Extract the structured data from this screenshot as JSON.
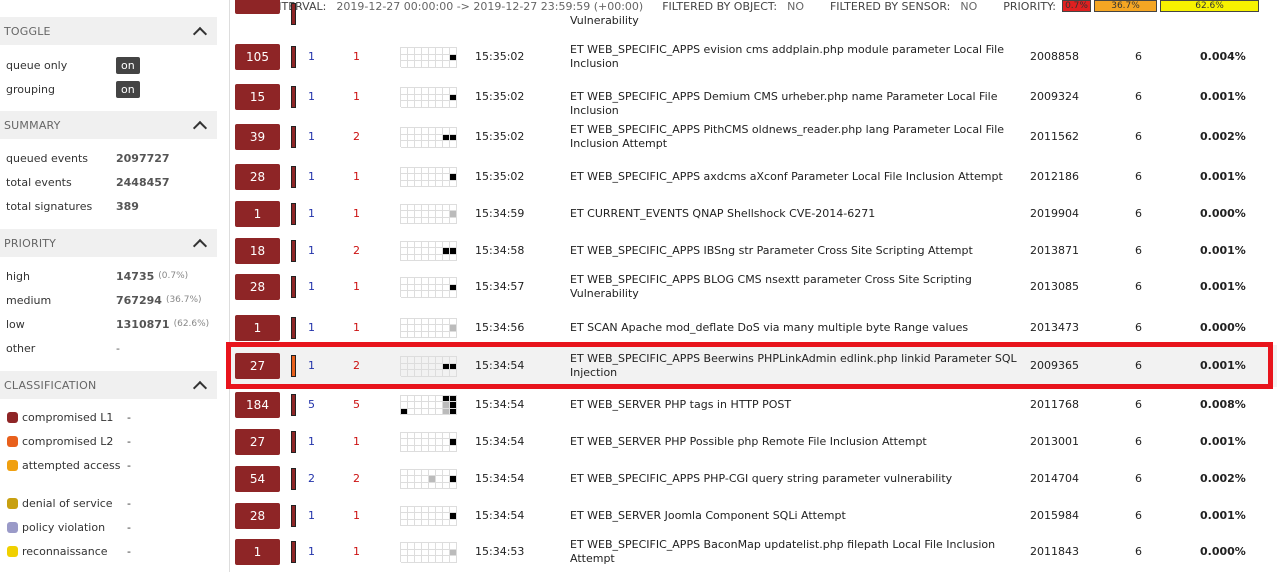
{
  "topbar": {
    "interval_label": "INTERVAL:",
    "interval_value": "2019-12-27 00:00:00 -> 2019-12-27 23:59:59 (+00:00)",
    "filter_object_label": "FILTERED BY OBJECT:",
    "filter_object_value": "NO",
    "filter_sensor_label": "FILTERED BY SENSOR:",
    "filter_sensor_value": "NO",
    "priority_label": "PRIORITY:",
    "priority_bars": [
      {
        "text": "0.7%",
        "color": "#e02020"
      },
      {
        "text": "36.7%",
        "color": "#f5a623"
      },
      {
        "text": "62.6%",
        "color": "#f7f200"
      }
    ]
  },
  "sidebar": {
    "toggle": {
      "title": "TOGGLE",
      "items": [
        {
          "label": "queue only",
          "value": "on"
        },
        {
          "label": "grouping",
          "value": "on"
        }
      ]
    },
    "summary": {
      "title": "SUMMARY",
      "items": [
        {
          "label": "queued events",
          "value": "2097727"
        },
        {
          "label": "total events",
          "value": "2448457"
        },
        {
          "label": "total signatures",
          "value": "389"
        }
      ]
    },
    "priority": {
      "title": "PRIORITY",
      "items": [
        {
          "label": "high",
          "value": "14735",
          "pct": "(0.7%)"
        },
        {
          "label": "medium",
          "value": "767294",
          "pct": "(36.7%)"
        },
        {
          "label": "low",
          "value": "1310871",
          "pct": "(62.6%)"
        },
        {
          "label": "other",
          "value": "-",
          "pct": ""
        }
      ]
    },
    "classification": {
      "title": "CLASSIFICATION",
      "items": [
        {
          "label": "compromised L1",
          "value": "-",
          "color": "#8e2526"
        },
        {
          "label": "compromised L2",
          "value": "-",
          "color": "#e8601c"
        },
        {
          "label": "attempted access",
          "value": "-",
          "color": "#f0a010"
        },
        {
          "label": "denial of service",
          "value": "-",
          "color": "#c8a010"
        },
        {
          "label": "policy violation",
          "value": "-",
          "color": "#9a9ac8"
        },
        {
          "label": "reconnaissance",
          "value": "-",
          "color": "#f0d000"
        }
      ]
    }
  },
  "events": [
    {
      "count": "",
      "n1": "",
      "n2": "",
      "time": "",
      "sig": "Vulnerability",
      "sid": "",
      "rev": "",
      "pct": "",
      "pri_color": "#8e2526",
      "cells": [],
      "partial": true
    },
    {
      "count": "105",
      "n1": "1",
      "n2": "1",
      "time": "15:35:02",
      "sig": "ET WEB_SPECIFIC_APPS evision cms addplain.php module parameter Local File Inclusion",
      "sid": "2008858",
      "rev": "6",
      "pct": "0.004%",
      "pri_color": "#8e2526",
      "cells": [
        [
          1,
          7,
          "#000"
        ]
      ]
    },
    {
      "count": "15",
      "n1": "1",
      "n2": "1",
      "time": "15:35:02",
      "sig": "ET WEB_SPECIFIC_APPS Demium CMS urheber.php name Parameter Local File Inclusion",
      "sid": "2009324",
      "rev": "6",
      "pct": "0.001%",
      "pri_color": "#8e2526",
      "cells": [
        [
          1,
          7,
          "#000"
        ]
      ]
    },
    {
      "count": "39",
      "n1": "1",
      "n2": "2",
      "time": "15:35:02",
      "sig": "ET WEB_SPECIFIC_APPS PithCMS oldnews_reader.php lang Parameter Local File Inclusion Attempt",
      "sid": "2011562",
      "rev": "6",
      "pct": "0.002%",
      "pri_color": "#8e2526",
      "cells": [
        [
          1,
          6,
          "#000"
        ],
        [
          1,
          7,
          "#000"
        ]
      ]
    },
    {
      "count": "28",
      "n1": "1",
      "n2": "1",
      "time": "15:35:02",
      "sig": "ET WEB_SPECIFIC_APPS axdcms aXconf Parameter Local File Inclusion Attempt",
      "sid": "2012186",
      "rev": "6",
      "pct": "0.001%",
      "pri_color": "#8e2526",
      "cells": [
        [
          1,
          7,
          "#000"
        ]
      ]
    },
    {
      "count": "1",
      "n1": "1",
      "n2": "1",
      "time": "15:34:59",
      "sig": "ET CURRENT_EVENTS QNAP Shellshock CVE-2014-6271",
      "sid": "2019904",
      "rev": "6",
      "pct": "0.000%",
      "pri_color": "#8e2526",
      "cells": [
        [
          1,
          7,
          "#bbb"
        ]
      ]
    },
    {
      "count": "18",
      "n1": "1",
      "n2": "2",
      "time": "15:34:58",
      "sig": "ET WEB_SPECIFIC_APPS IBSng str Parameter Cross Site Scripting Attempt",
      "sid": "2013871",
      "rev": "6",
      "pct": "0.001%",
      "pri_color": "#8e2526",
      "cells": [
        [
          1,
          6,
          "#000"
        ],
        [
          1,
          7,
          "#000"
        ]
      ]
    },
    {
      "count": "28",
      "n1": "1",
      "n2": "1",
      "time": "15:34:57",
      "sig": "ET WEB_SPECIFIC_APPS BLOG CMS nsextt parameter Cross Site Scripting Vulnerability",
      "sid": "2013085",
      "rev": "6",
      "pct": "0.001%",
      "pri_color": "#8e2526",
      "cells": [
        [
          1,
          7,
          "#000"
        ]
      ]
    },
    {
      "count": "1",
      "n1": "1",
      "n2": "1",
      "time": "15:34:56",
      "sig": "ET SCAN Apache mod_deflate DoS via many multiple byte Range values",
      "sid": "2013473",
      "rev": "6",
      "pct": "0.000%",
      "pri_color": "#8e2526",
      "cells": [
        [
          1,
          7,
          "#bbb"
        ]
      ]
    },
    {
      "count": "27",
      "n1": "1",
      "n2": "2",
      "time": "15:34:54",
      "sig": "ET WEB_SPECIFIC_APPS Beerwins PHPLinkAdmin edlink.php linkid Parameter SQL Injection",
      "sid": "2009365",
      "rev": "6",
      "pct": "0.001%",
      "pri_color": "#e8601c",
      "cells": [
        [
          1,
          6,
          "#000"
        ],
        [
          1,
          7,
          "#000"
        ]
      ],
      "selected": true
    },
    {
      "count": "184",
      "n1": "5",
      "n2": "5",
      "time": "15:34:54",
      "sig": "ET WEB_SERVER PHP tags in HTTP POST",
      "sid": "2011768",
      "rev": "6",
      "pct": "0.008%",
      "pri_color": "#8e2526",
      "cells": [
        [
          2,
          0,
          "#000"
        ],
        [
          0,
          6,
          "#000"
        ],
        [
          0,
          7,
          "#000"
        ],
        [
          1,
          6,
          "#bbb"
        ],
        [
          1,
          7,
          "#000"
        ],
        [
          2,
          6,
          "#bbb"
        ],
        [
          2,
          7,
          "#000"
        ]
      ]
    },
    {
      "count": "27",
      "n1": "1",
      "n2": "1",
      "time": "15:34:54",
      "sig": "ET WEB_SERVER PHP Possible php Remote File Inclusion Attempt",
      "sid": "2013001",
      "rev": "6",
      "pct": "0.001%",
      "pri_color": "#8e2526",
      "cells": [
        [
          1,
          7,
          "#000"
        ]
      ]
    },
    {
      "count": "54",
      "n1": "2",
      "n2": "2",
      "time": "15:34:54",
      "sig": "ET WEB_SPECIFIC_APPS PHP-CGI query string parameter vulnerability",
      "sid": "2014704",
      "rev": "6",
      "pct": "0.002%",
      "pri_color": "#8e2526",
      "cells": [
        [
          1,
          4,
          "#bbb"
        ],
        [
          1,
          7,
          "#000"
        ]
      ]
    },
    {
      "count": "28",
      "n1": "1",
      "n2": "1",
      "time": "15:34:54",
      "sig": "ET WEB_SERVER Joomla Component SQLi Attempt",
      "sid": "2015984",
      "rev": "6",
      "pct": "0.001%",
      "pri_color": "#8e2526",
      "cells": [
        [
          1,
          7,
          "#000"
        ]
      ]
    },
    {
      "count": "1",
      "n1": "1",
      "n2": "1",
      "time": "15:34:53",
      "sig": "ET WEB_SPECIFIC_APPS BaconMap updatelist.php filepath Local File Inclusion Attempt",
      "sid": "2011843",
      "rev": "6",
      "pct": "0.000%",
      "pri_color": "#8e2526",
      "cells": [
        [
          1,
          7,
          "#bbb"
        ]
      ]
    }
  ]
}
